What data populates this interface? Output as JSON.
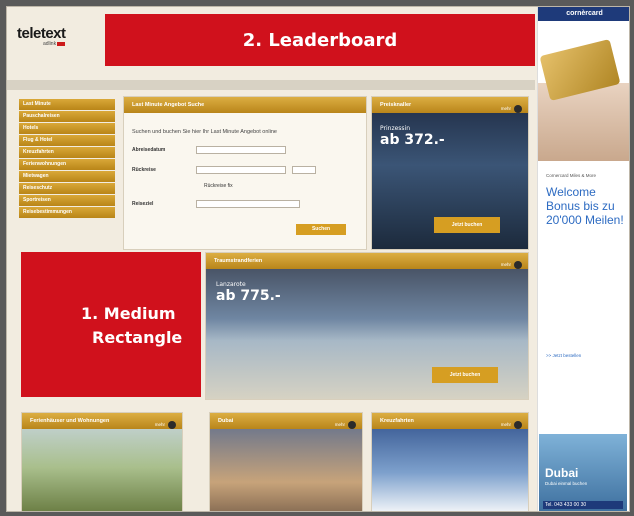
{
  "header": {
    "logo": "teletext",
    "logo_sub": "adlink",
    "leaderboard": "2. Leaderboard"
  },
  "nav": {
    "items": [
      "Last Minute",
      "Pauschalreisen",
      "Hotels",
      "Flug & Hotel",
      "Kreuzfahrten",
      "Ferienwohnungen",
      "Mietwagen",
      "Reiseschutz",
      "Sportreisen",
      "Reisebestimmungen"
    ]
  },
  "search": {
    "title": "Last Minute Angebot Suche",
    "intro": "Suchen und buchen Sie hier Ihr Last Minute Angebot online",
    "label_date": "Abreisedatum",
    "label_return": "Rückreise",
    "option_return": "Rückreise fix",
    "label_region": "Reiseziel",
    "button": "Suchen"
  },
  "promo_top": {
    "head": "Preisknaller",
    "more": "mehr",
    "dest": "Prinzessin",
    "price": "ab 372.-",
    "button": "Jetzt buchen"
  },
  "promo_mid": {
    "head": "Traumstrandferien",
    "more": "mehr",
    "dest": "Lanzarote",
    "price": "ab 775.-",
    "button": "Jetzt buchen"
  },
  "medium_rect": {
    "line1": "1. Medium",
    "line2": "Rectangle"
  },
  "bottom_panels": [
    {
      "head": "Ferienhäuser und Wohnungen",
      "more": "mehr"
    },
    {
      "head": "Dubai",
      "more": "mehr"
    },
    {
      "head": "Kreuzfahrten",
      "more": "mehr"
    }
  ],
  "skyscraper": {
    "brand": "cornèrcard",
    "tiny": "Cornercard Miles & More",
    "welcome": "Welcome Bonus bis zu 20'000 Meilen!",
    "link": ">> Jetzt bestellen"
  },
  "dubai_ad": {
    "title": "Dubai",
    "sub": "Dubai einmal buchen",
    "phone": "Tel. 043 433 00 30"
  }
}
